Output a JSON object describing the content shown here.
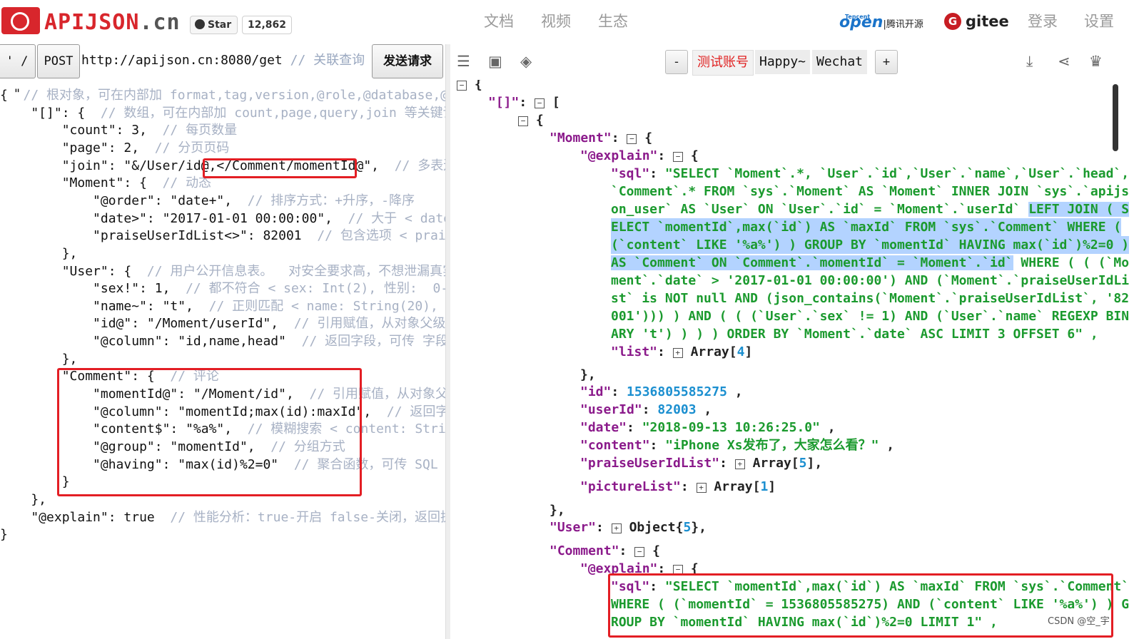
{
  "header": {
    "brand": "APIJSON",
    "brand_suffix": ".cn",
    "github_star_label": "Star",
    "github_star_count": "12,862",
    "nav": [
      "文档",
      "视频",
      "生态"
    ],
    "tencent_open_small": "Tencent",
    "tencent_open_word": "open",
    "tencent_open_suffix": "|腾讯开源",
    "gitee_label": "gitee",
    "login_label": "登录",
    "settings_label": "设置"
  },
  "request_bar": {
    "quote_button": "' / \"",
    "method_button": "POST",
    "url": "http://apijson.cn:8080/get",
    "url_comment": " // 关联查询",
    "send_button": "发送请求"
  },
  "left_code": [
    {
      "code": "{  ",
      "comment": "// 根对象，可在内部加 format,tag,version,@role,@database,@s"
    },
    {
      "code": "    \"[]\": {  ",
      "comment": "// 数组，可在内部加 count,page,query,join 等关键词"
    },
    {
      "code": "        \"count\": 3,  ",
      "comment": "// 每页数量"
    },
    {
      "code": "        \"page\": 2,  ",
      "comment": "// 分页页码"
    },
    {
      "code": "        \"join\": \"&/User/id@,</Comment/momentId@\",  ",
      "comment": "// 多表连接"
    },
    {
      "code": "        \"Moment\": {  ",
      "comment": "// 动态"
    },
    {
      "code": "            \"@order\": \"date+\",  ",
      "comment": "// 排序方式：+升序，-降序"
    },
    {
      "code": "            \"date>\": \"2017-01-01 00:00:00\",  ",
      "comment": "// 大于 < date:"
    },
    {
      "code": "            \"praiseUserIdList<>\": 82001  ",
      "comment": "// 包含选项 < praise"
    },
    {
      "code": "        },",
      "comment": ""
    },
    {
      "code": "        \"User\": {  ",
      "comment": "// 用户公开信息表。  对安全要求高，不想泄漏真实名"
    },
    {
      "code": "            \"sex!\": 1,  ",
      "comment": "// 都不符合 < sex: Int(2), 性别:  0-男"
    },
    {
      "code": "            \"name~\": \"t\",  ",
      "comment": "// 正则匹配 < name: String(20), 名"
    },
    {
      "code": "            \"id@\": \"/Moment/userId\",  ",
      "comment": "// 引用赋值，从对象父级开始"
    },
    {
      "code": "            \"@column\": \"id,name,head\"  ",
      "comment": "// 返回字段，可传 字段(:"
    },
    {
      "code": "        },",
      "comment": ""
    },
    {
      "code": "        \"Comment\": {  ",
      "comment": "// 评论"
    },
    {
      "code": "            \"momentId@\": \"/Moment/id\",  ",
      "comment": "// 引用赋值，从对象父级"
    },
    {
      "code": "            \"@column\": \"momentId;max(id):maxId\",  ",
      "comment": "// 返回字段"
    },
    {
      "code": "            \"content$\": \"%a%\",  ",
      "comment": "// 模糊搜索 < content: String"
    },
    {
      "code": "            \"@group\": \"momentId\",  ",
      "comment": "// 分组方式"
    },
    {
      "code": "            \"@having\": \"max(id)%2=0\"  ",
      "comment": "// 聚合函数，可传 SQL 函"
    },
    {
      "code": "        }",
      "comment": ""
    },
    {
      "code": "    },",
      "comment": ""
    },
    {
      "code": "    \"@explain\": true  ",
      "comment": "// 性能分析：true-开启 false-关闭，返回执行"
    },
    {
      "code": "}",
      "comment": ""
    }
  ],
  "right_toolbar": {
    "minus_label": "-",
    "account_label": "测试账号",
    "account_name": "Happy~",
    "account_type": "Wechat",
    "plus_label": "+"
  },
  "json_tree": {
    "open_brace": "{",
    "array_key": "\"[]\"",
    "array_open": "[",
    "item_open": "{",
    "moment_key": "\"Moment\"",
    "moment_open": "{",
    "explain_key": "\"@explain\"",
    "explain_open": "{",
    "sql_key": "\"sql\"",
    "moment_sql_lines": [
      "\"SELECT `Moment`.*, `User`.`id`,`User`.`name`,`User`.`head`,",
      "`Comment`.* FROM `sys`.`Moment` AS `Moment` INNER JOIN `sys`.`apijs",
      "on_user` AS `User` ON `User`.`id` = `Moment`.`userId` ",
      "LEFT JOIN ( S",
      "ELECT `momentId`,max(`id`) AS `maxId` FROM `sys`.`Comment` WHERE (",
      "(`content` LIKE '%a%') ) GROUP BY `momentId` HAVING max(`id`)%2=0 )",
      "AS `Comment` ON `Comment`.`momentId` = `Moment`.`id`",
      " WHERE ( ( (`Mo",
      "ment`.`date` > '2017-01-01 00:00:00') AND (`Moment`.`praiseUserIdLi",
      "st` is NOT null AND (json_contains(`Moment`.`praiseUserIdList`, '82",
      "001'))) ) AND ( ( (`User`.`sex` != 1) AND (`User`.`name` REGEXP BIN",
      "ARY 't') ) ) ) ORDER BY `Moment`.`date` ASC LIMIT 3 OFFSET 6\" ,"
    ],
    "list_key": "\"list\"",
    "list_type": "Array",
    "list_count": "4",
    "explain_close": "},",
    "id_key": "\"id\"",
    "id_value": "1536805585275",
    "userid_key": "\"userId\"",
    "userid_value": "82003",
    "date_key": "\"date\"",
    "date_value": "\"2018-09-13 10:26:25.0\"",
    "content_key": "\"content\"",
    "content_value": "\"iPhone Xs发布了，大家怎么看？\"",
    "praise_key": "\"praiseUserIdList\"",
    "praise_type": "Array",
    "praise_count": "5",
    "picture_key": "\"pictureList\"",
    "picture_type": "Array",
    "picture_count": "1",
    "moment_close": "},",
    "user_key": "\"User\"",
    "user_type": "Object",
    "user_count": "5",
    "comment_key": "\"Comment\"",
    "comment_open": "{",
    "comment_explain_key": "\"@explain\"",
    "comment_explain_open": "{",
    "comment_sql_lines": [
      "\"SELECT `momentId`,max(`id`) AS `maxId` FROM `sys`.`Comment`",
      "WHERE ( (`momentId` = 1536805585275) AND (`content` LIKE '%a%') ) G",
      "ROUP BY `momentId` HAVING max(`id`)%2=0 LIMIT 1\" ,"
    ]
  },
  "watermark": "CSDN @空_宇"
}
